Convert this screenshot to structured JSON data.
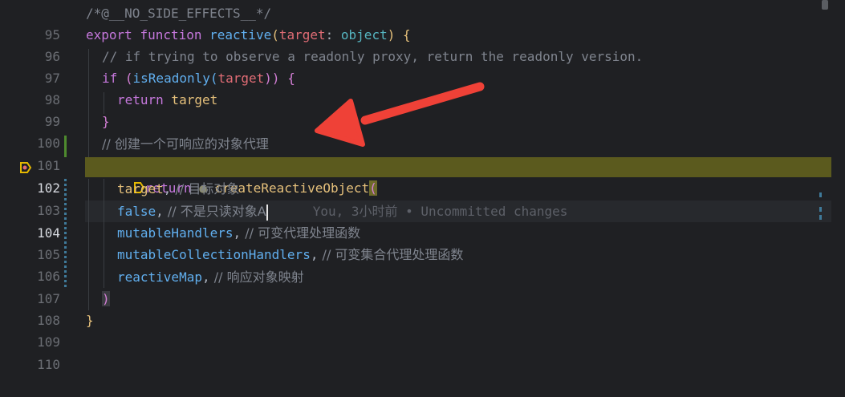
{
  "colors": {
    "background": "#1f2023",
    "highlight_line": "#5b5a1e",
    "arrow": "#ef4137",
    "diff_added": "#4e8a2e",
    "diff_modified": "#3f7a9a"
  },
  "lines": {
    "l95": {
      "num": "95",
      "text": "/*@__NO_SIDE_EFFECTS__*/"
    },
    "l96": {
      "num": "96",
      "kw": "export",
      "kw2": "function",
      "fn": "reactive",
      "p1": "(",
      "param": "target",
      "colon": ": ",
      "type": "object",
      "p2": ")",
      "brace": " {"
    },
    "l97": {
      "num": "97",
      "text": "// if trying to observe a readonly proxy, return the readonly version."
    },
    "l98": {
      "num": "98",
      "kw": "if",
      "p1": " (",
      "fn": "isReadonly",
      "p2": "(",
      "arg": "target",
      "p3": "))",
      "brace": " {"
    },
    "l99": {
      "num": "99",
      "kw": "return",
      "arg": " target"
    },
    "l100": {
      "num": "100",
      "brace": "}"
    },
    "l101": {
      "num": "101",
      "text": "// 创建一个可响应的对象代理"
    },
    "l102": {
      "num": "102",
      "kw": "return",
      "fn": "createReactiveObject",
      "p1": "("
    },
    "l103": {
      "num": "103",
      "arg": "target",
      "comma": ",",
      "cmt": " // 目标对象"
    },
    "l104": {
      "num": "104",
      "arg": "false",
      "comma": ",",
      "cmt": " // 不是只读对象A",
      "ghost": "You, 3小时前 • Uncommitted changes"
    },
    "l105": {
      "num": "105",
      "arg": "mutableHandlers",
      "comma": ",",
      "cmt": " // 可变代理处理函数"
    },
    "l106": {
      "num": "106",
      "arg": "mutableCollectionHandlers",
      "comma": ",",
      "cmt": " // 可变集合代理处理函数"
    },
    "l107": {
      "num": "107",
      "arg": "reactiveMap",
      "comma": ",",
      "cmt": " // 响应对象映射"
    },
    "l108": {
      "num": "108",
      "p1": ")"
    },
    "l109": {
      "num": "109",
      "brace": "}"
    },
    "l110": {
      "num": "110"
    }
  }
}
